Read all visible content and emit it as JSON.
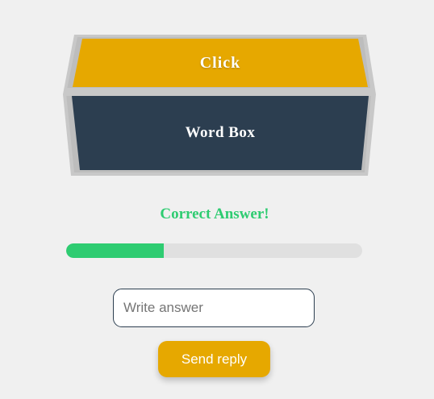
{
  "word_box": {
    "lid_label": "Click",
    "body_label": "Word Box"
  },
  "feedback": {
    "text": "Correct Answer!"
  },
  "progress": {
    "fraction": 0.33
  },
  "answer_input": {
    "value": "",
    "placeholder": "Write answer"
  },
  "send_button": {
    "label": "Send reply"
  },
  "colors": {
    "background": "#f0f0f0",
    "lid": "#e6a800",
    "box_body": "#2c3e50",
    "frame": "#c8c8c8",
    "success": "#2ecc71",
    "track": "#e0e0e0",
    "button": "#e6a800"
  }
}
